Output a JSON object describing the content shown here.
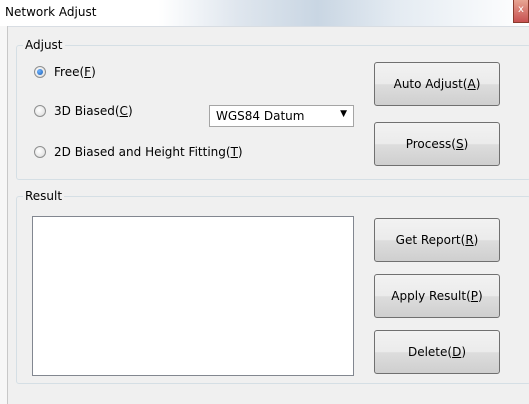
{
  "window": {
    "title": "Network Adjust",
    "close_glyph": "x",
    "close_icon": "close-icon"
  },
  "adjust": {
    "legend": "Adjust",
    "options": [
      {
        "label_pre": "Free(",
        "key": "F",
        "label_post": ")",
        "checked": true
      },
      {
        "label_pre": "3D Biased(",
        "key": "C",
        "label_post": ")",
        "checked": false
      },
      {
        "label_pre": "2D Biased and Height Fitting(",
        "key": "T",
        "label_post": ")",
        "checked": false
      }
    ],
    "datum": {
      "value": "WGS84 Datum",
      "arrow_icon": "dropdown-arrow-icon"
    },
    "buttons": {
      "auto_adjust": {
        "pre": "Auto Adjust(",
        "key": "A",
        "post": ")"
      },
      "process": {
        "pre": "Process(",
        "key": "S",
        "post": ")"
      }
    }
  },
  "result": {
    "legend": "Result",
    "buttons": {
      "get_report": {
        "pre": "Get Report(",
        "key": "R",
        "post": ")"
      },
      "apply_result": {
        "pre": "Apply Result(",
        "key": "P",
        "post": ")"
      },
      "delete": {
        "pre": "Delete(",
        "key": "D",
        "post": ")"
      }
    }
  }
}
